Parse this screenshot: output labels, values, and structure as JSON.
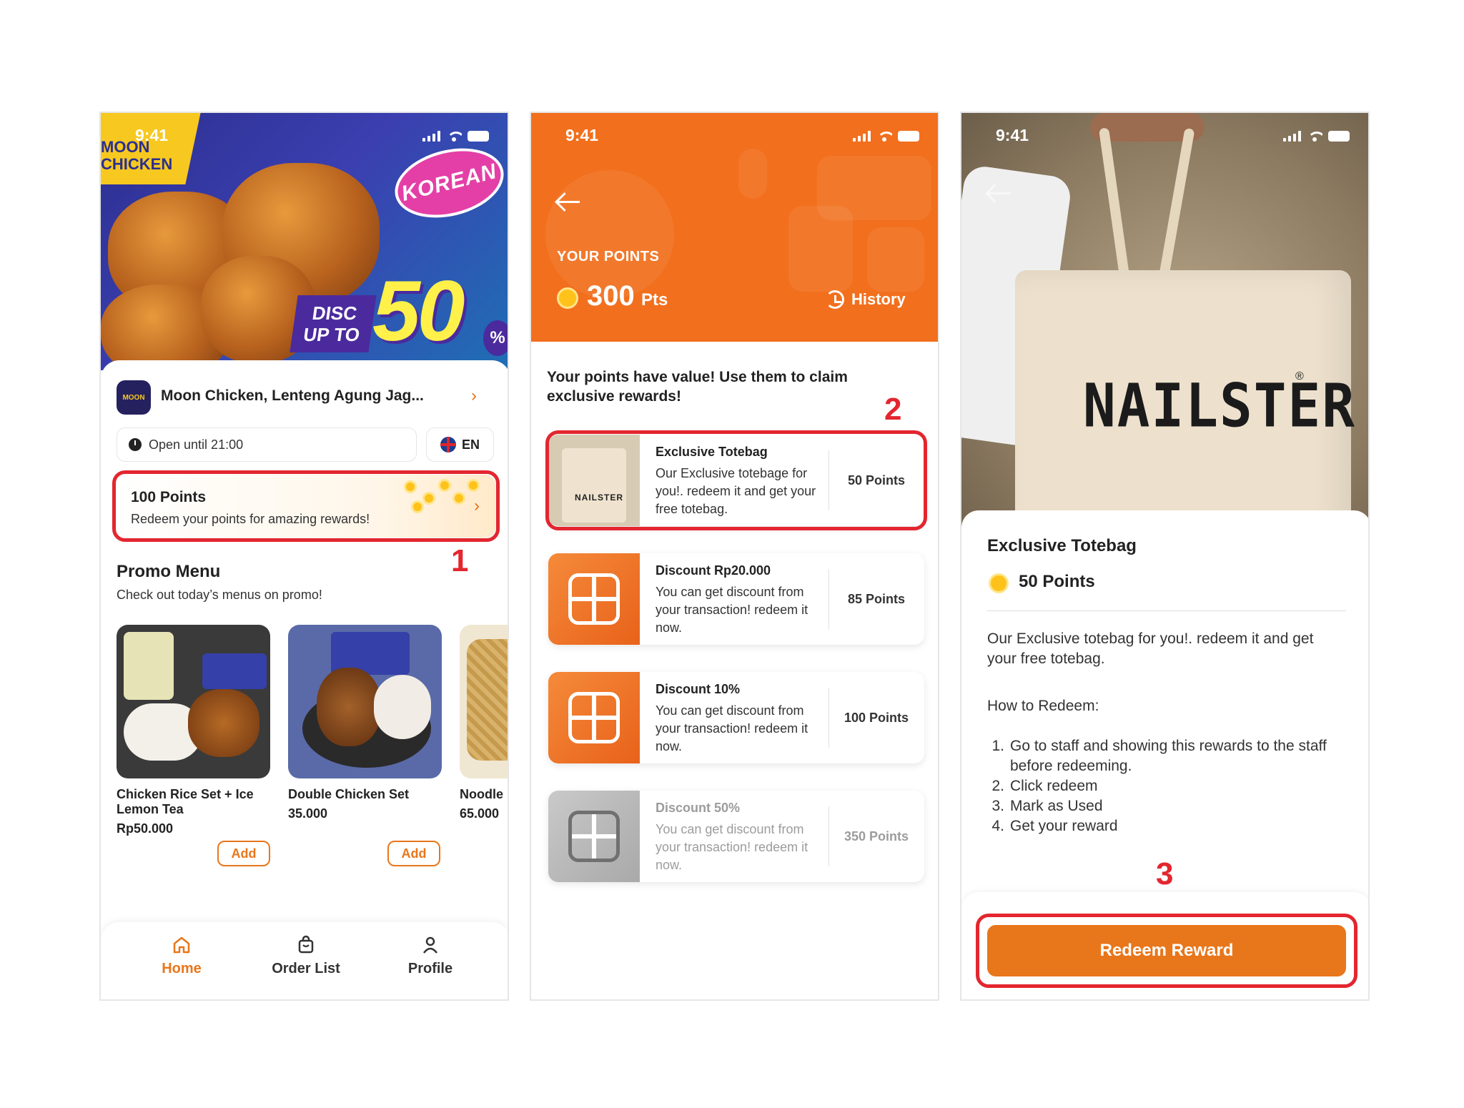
{
  "status_time": "9:41",
  "screen1": {
    "banner": {
      "brand": "MOON CHICKEN",
      "sticker": "KOREAN",
      "disc_line1": "DISC",
      "disc_line2": "UP TO",
      "discount": "50",
      "percent": "%"
    },
    "store_name": "Moon Chicken, Lenteng Agung Jag...",
    "open_until": "Open until 21:00",
    "language": "EN",
    "points_title": "100 Points",
    "points_sub": "Redeem your points for amazing rewards!",
    "step_label": "1",
    "promo_title": "Promo Menu",
    "promo_sub": "Check out today’s menus on promo!",
    "menu": [
      {
        "name": "Chicken Rice Set + Ice Lemon Tea",
        "price": "Rp50.000",
        "add": "Add"
      },
      {
        "name": "Double Chicken Set",
        "price": "35.000",
        "add": "Add"
      },
      {
        "name": "Noodle",
        "price": "65.000"
      }
    ],
    "nav": [
      {
        "label": "Home",
        "icon": "home-icon"
      },
      {
        "label": "Order List",
        "icon": "bag-icon"
      },
      {
        "label": "Profile",
        "icon": "user-icon"
      }
    ]
  },
  "screen2": {
    "your_points_label": "YOUR POINTS",
    "points_value": "300",
    "points_unit": "Pts",
    "history": "History",
    "intro": "Your points have value! Use them to claim exclusive rewards!",
    "step_label": "2",
    "rewards": [
      {
        "name": "Exclusive Totebag",
        "desc": "Our Exclusive totebage for you!. redeem it and get your free totebag.",
        "points": "50 Points",
        "thumb": "NAILSTER"
      },
      {
        "name": "Discount Rp20.000",
        "desc": "You can get discount from your transaction! redeem it now.",
        "points": "85 Points"
      },
      {
        "name": "Discount 10%",
        "desc": "You can get discount from your transaction! redeem it now.",
        "points": "100 Points"
      },
      {
        "name": "Discount 50%",
        "desc": "You can get discount from your transaction! redeem it now.",
        "points": "350 Points"
      }
    ]
  },
  "screen3": {
    "bag_brand": "NAILSTER",
    "title": "Exclusive Totebag",
    "points": "50 Points",
    "desc": "Our Exclusive totebag for you!. redeem it and get your free totebag.",
    "how_title": "How to Redeem:",
    "steps": [
      {
        "n": "1.",
        "text": "Go to staff and showing this rewards to the staff before redeeming."
      },
      {
        "n": "2.",
        "text": "Click redeem"
      },
      {
        "n": "3.",
        "text": "Mark as Used"
      },
      {
        "n": "4.",
        "text": "Get your reward"
      }
    ],
    "step_label": "3",
    "button": "Redeem Reward"
  },
  "colors": {
    "primary": "#e8761b",
    "header_orange": "#f26f1d",
    "highlight_red": "#e3262f",
    "coin": "#ffc21a"
  }
}
